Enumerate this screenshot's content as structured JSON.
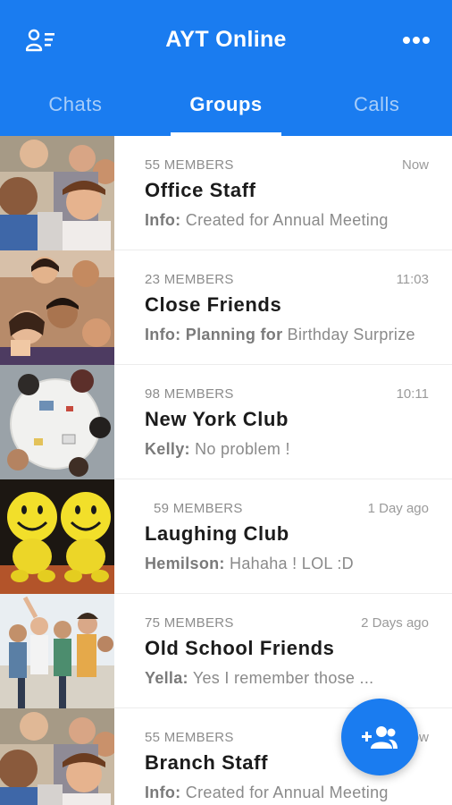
{
  "app": {
    "title": "AYT Online",
    "accent": "#1a7cf0"
  },
  "icons": {
    "left": "contacts-list-icon",
    "right": "more-horizontal-icon",
    "fab": "add-group-icon"
  },
  "tabs": [
    {
      "label": "Chats",
      "active": false
    },
    {
      "label": "Groups",
      "active": true
    },
    {
      "label": "Calls",
      "active": false
    }
  ],
  "groups": [
    {
      "members": "55 MEMBERS",
      "time": "Now",
      "name": "Office Staff",
      "who": "Info:",
      "message": " Created for Annual Meeting",
      "image": "group-photo-office"
    },
    {
      "members": "23 MEMBERS",
      "time": "11:03",
      "name": "Close Friends",
      "who": "Info: Planning for",
      "message": " Birthday Surprize",
      "image": "group-photo-friends-selfie"
    },
    {
      "members": "98 MEMBERS",
      "time": "10:11",
      "name": "New York Club",
      "who": "Kelly:",
      "message": " No problem !",
      "image": "group-photo-team-table"
    },
    {
      "members": "59 MEMBERS",
      "time": "1 Day ago",
      "name": "Laughing Club",
      "who": "Hemilson:",
      "message": " Hahaha ! LOL :D",
      "image": "smiley-toys-photo"
    },
    {
      "members": "75 MEMBERS",
      "time": "2 Days ago",
      "name": "Old School Friends",
      "who": "Yella:",
      "message": " Yes I remember those ...",
      "image": "group-photo-celebration"
    },
    {
      "members": "55 MEMBERS",
      "time": "Now",
      "name": "Branch Staff",
      "who": "Info:",
      "message": " Created for Annual Meeting",
      "image": "group-photo-office"
    }
  ]
}
